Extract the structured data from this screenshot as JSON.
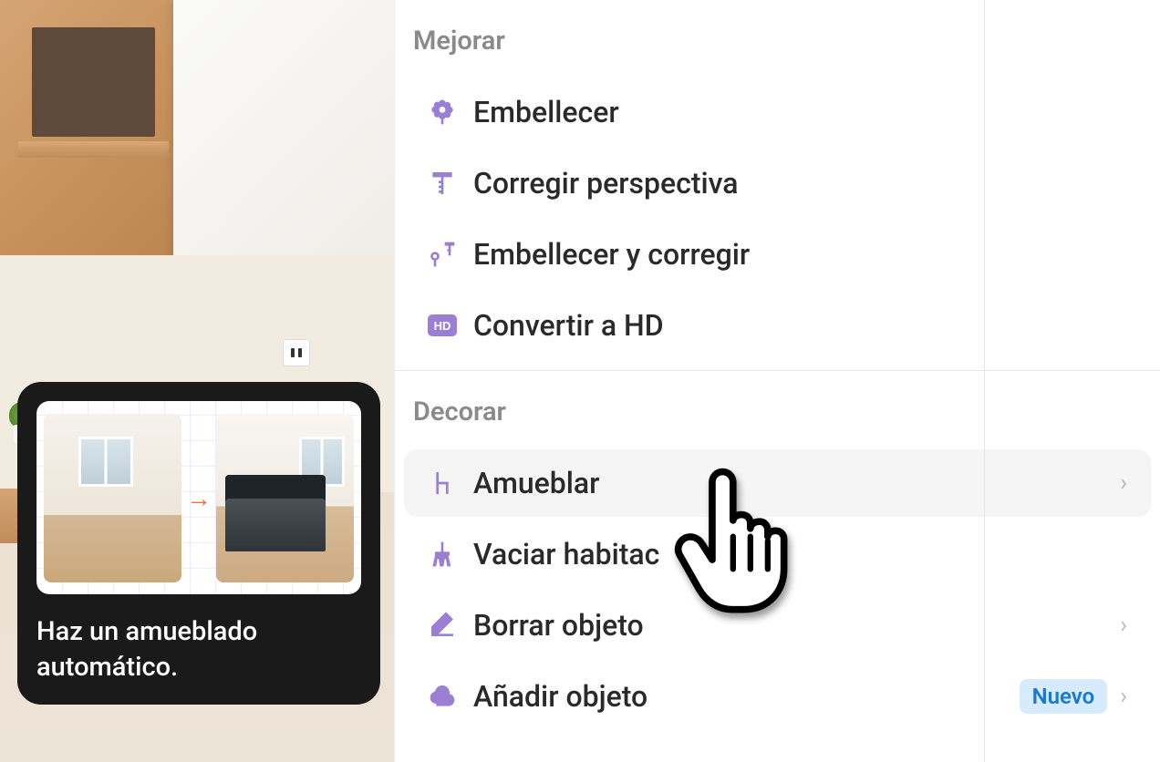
{
  "tooltip": {
    "text": "Haz un amueblado automático.",
    "arrow": "→"
  },
  "sections": {
    "improve": {
      "title": "Mejorar",
      "items": {
        "beautify": "Embellecer",
        "perspective": "Corregir perspectiva",
        "beautify_correct": "Embellecer y corregir",
        "hd": "Convertir a HD"
      }
    },
    "decorate": {
      "title": "Decorar",
      "items": {
        "furnish": "Amueblar",
        "empty_room": "Vaciar habitac",
        "erase_object": "Borrar objeto",
        "add_object": "Añadir objeto"
      },
      "badge_new": "Nuevo"
    }
  },
  "icons": {
    "hd_label": "HD"
  },
  "colors": {
    "accent_purple": "#9b7fd4",
    "badge_bg": "#d6ebff",
    "badge_text": "#1a77d4",
    "arrow": "#ff6b35"
  }
}
